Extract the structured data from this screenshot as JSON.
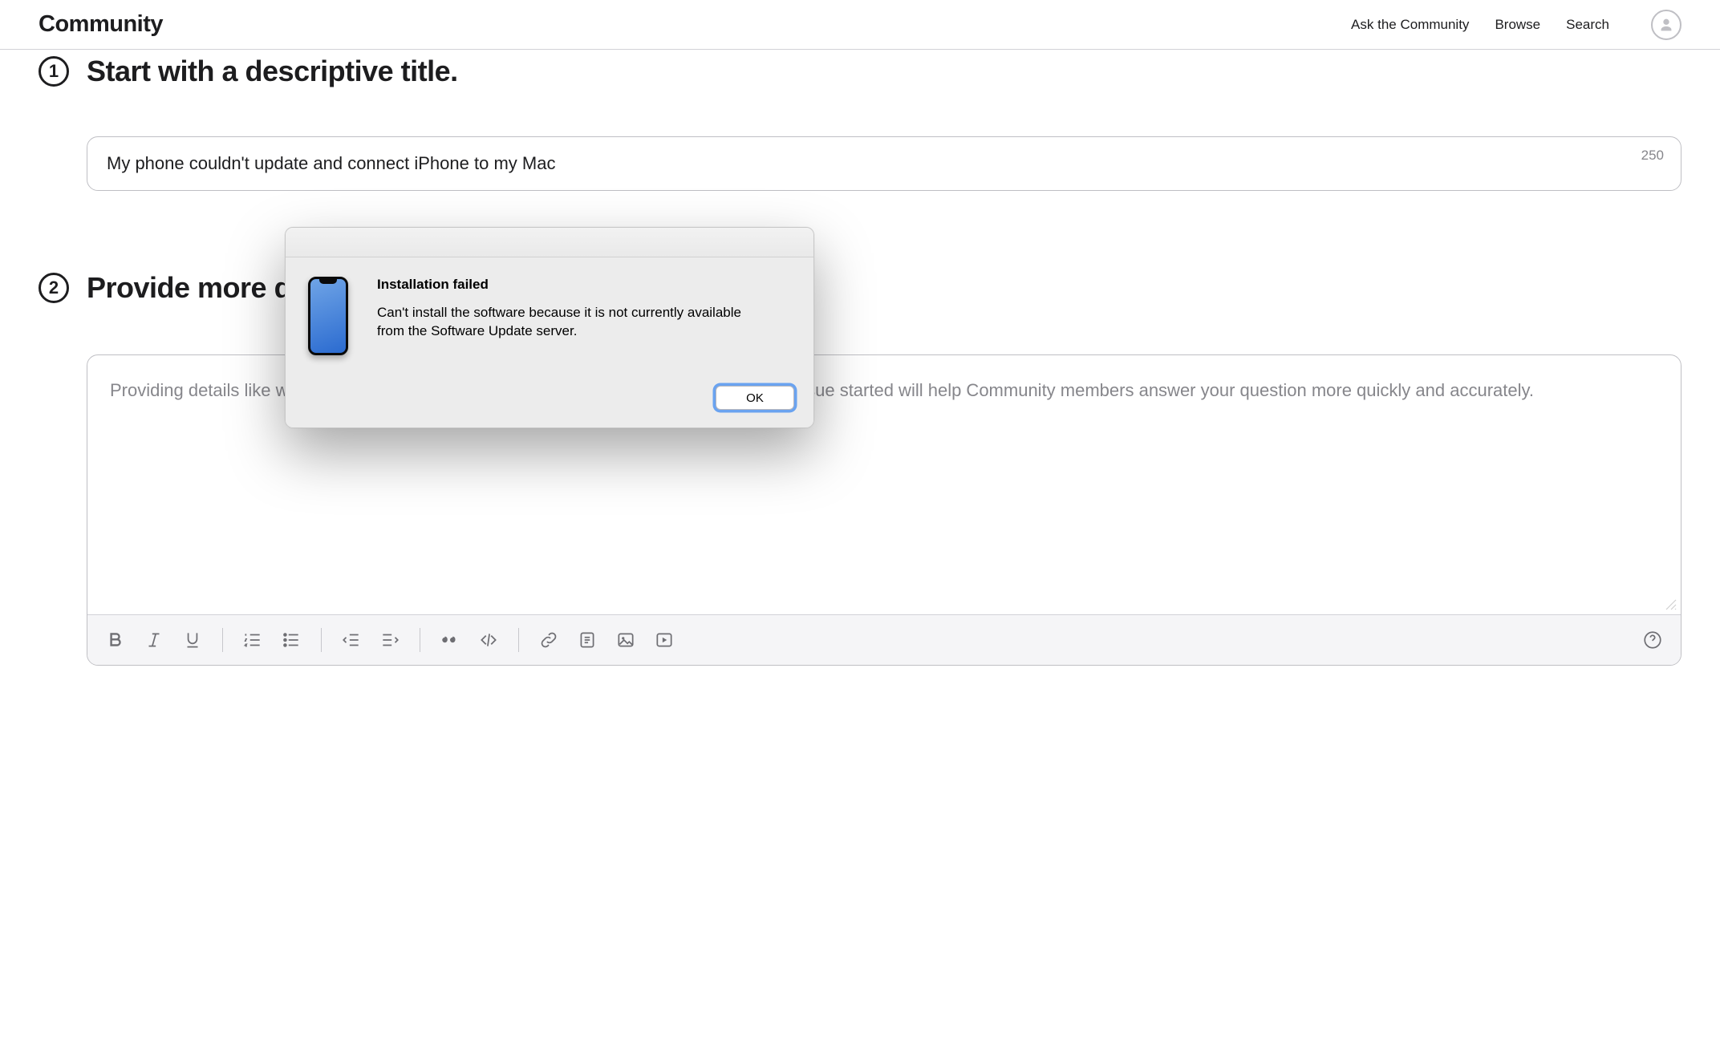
{
  "header": {
    "brand": "Community",
    "nav": {
      "ask": "Ask the Community",
      "browse": "Browse",
      "search": "Search"
    }
  },
  "step1": {
    "number": "1",
    "title": "Start with a descriptive title.",
    "input_value": "My phone couldn't update and connect iPhone to my Mac",
    "char_limit": "250"
  },
  "step2": {
    "number": "2",
    "title": "Provide more details.",
    "placeholder": "Providing details like what device you're using, what you've already tried, and when the issue started will help Community members answer your question more quickly and accurately."
  },
  "dialog": {
    "title": "Installation failed",
    "message": "Can't install the software because it is not currently available from the Software Update server.",
    "ok_label": "OK"
  }
}
